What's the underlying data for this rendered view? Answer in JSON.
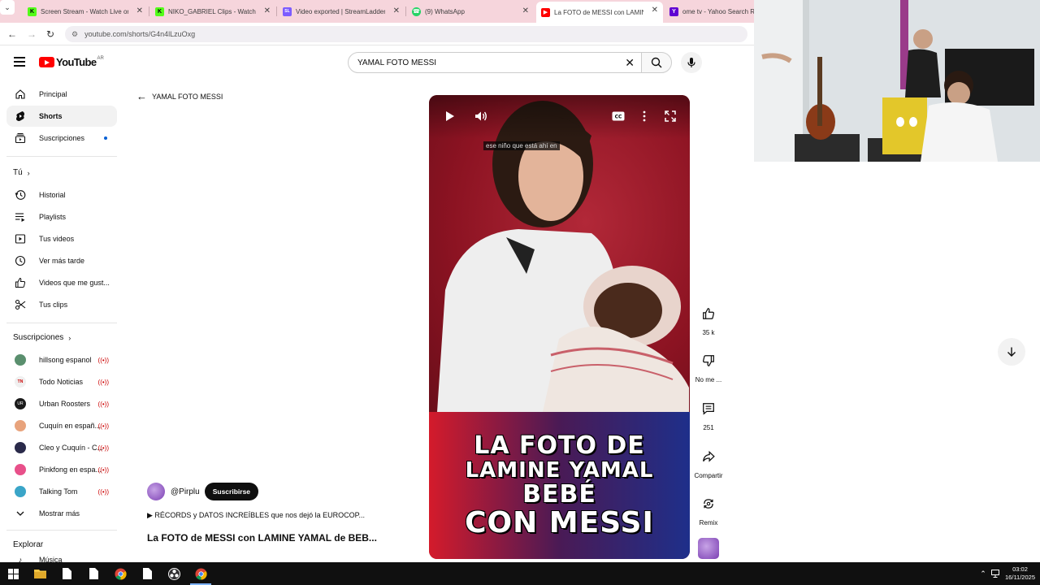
{
  "browser": {
    "tabs": [
      {
        "title": "Screen Stream - Watch Live on",
        "icon": "kick-icon",
        "color": "#53fc18",
        "letter": "K"
      },
      {
        "title": "NIKO_GABRIEL Clips - Watch Li",
        "icon": "kick-icon",
        "color": "#53fc18",
        "letter": "K"
      },
      {
        "title": "Video exported | StreamLadder",
        "icon": "streamladder-icon",
        "color": "#7c5cff",
        "letter": "SL"
      },
      {
        "title": "(9) WhatsApp",
        "icon": "whatsapp-icon",
        "color": "#25d366",
        "letter": ""
      },
      {
        "title": "La FOTO de MESSI con LAMINE",
        "icon": "youtube-icon",
        "color": "#ff0000",
        "letter": ""
      },
      {
        "title": "ome tv - Yahoo Search Re",
        "icon": "yahoo-icon",
        "color": "#6001d2",
        "letter": "Y"
      }
    ],
    "url": "youtube.com/shorts/G4n4lLzuOxg"
  },
  "youtube": {
    "logo_text": "YouTube",
    "region": "AR",
    "search_value": "YAMAL FOTO MESSI",
    "sidebar": {
      "main": [
        {
          "label": "Principal",
          "icon": "home-icon"
        },
        {
          "label": "Shorts",
          "icon": "shorts-icon"
        },
        {
          "label": "Suscripciones",
          "icon": "subscriptions-icon"
        }
      ],
      "you_heading": "Tú",
      "you_items": [
        {
          "label": "Historial",
          "icon": "history-icon"
        },
        {
          "label": "Playlists",
          "icon": "playlists-icon"
        },
        {
          "label": "Tus videos",
          "icon": "your-videos-icon"
        },
        {
          "label": "Ver más tarde",
          "icon": "watch-later-icon"
        },
        {
          "label": "Videos que me gust...",
          "icon": "liked-icon"
        },
        {
          "label": "Tus clips",
          "icon": "clips-icon"
        }
      ],
      "subs_heading": "Suscripciones",
      "subs": [
        {
          "label": "hillsong espanol",
          "avatar_color": "#5a8f6e"
        },
        {
          "label": "Todo Noticias",
          "avatar_color": "#e8e8e8"
        },
        {
          "label": "Urban Roosters",
          "avatar_color": "#1a1a1a"
        },
        {
          "label": "Cuquín en españ...",
          "avatar_color": "#e8a37c"
        },
        {
          "label": "Cleo y Cuquín - C...",
          "avatar_color": "#2a2a4a"
        },
        {
          "label": "Pinkfong en espa...",
          "avatar_color": "#e8508a"
        },
        {
          "label": "Talking Tom",
          "avatar_color": "#3aa5c8"
        }
      ],
      "show_more": "Mostrar más",
      "explore_heading": "Explorar",
      "explore_partial": "Música"
    },
    "back_label": "YAMAL FOTO MESSI",
    "player": {
      "caption": "ese niño que está ahí en",
      "banner_lines": [
        "LA FOTO DE",
        "LAMINE YAMAL",
        "BEBÉ",
        "CON MESSI"
      ]
    },
    "actions": {
      "likes": "35 k",
      "dislike_label": "No me ...",
      "comments": "251",
      "share_label": "Compartir",
      "remix_label": "Remix"
    },
    "channel": {
      "handle": "@Pirplu",
      "subscribe_label": "Suscribirse"
    },
    "playlist_label": "RÉCORDS y DATOS INCREÍBLES que nos dejó la EUROCOP...",
    "video_title": "La FOTO de MESSI con LAMINE YAMAL de BEB..."
  },
  "taskbar": {
    "time": "03:02",
    "date": "16/11/2025"
  }
}
